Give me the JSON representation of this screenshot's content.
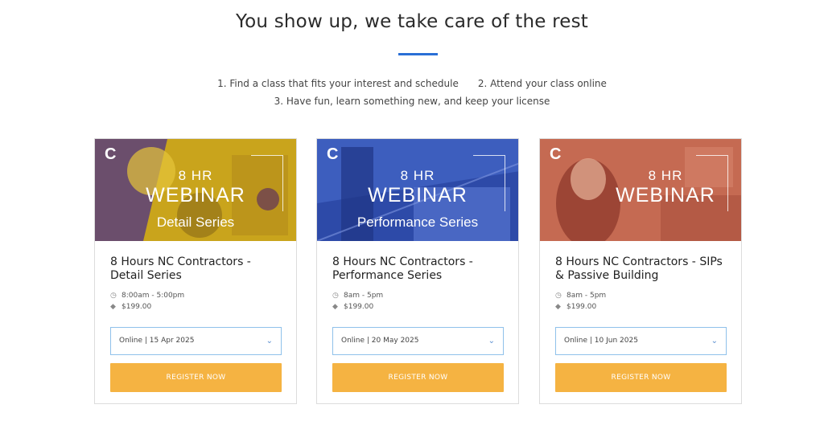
{
  "header": {
    "title": "You show up, we take care of the rest",
    "steps_row1": [
      "1. Find a class that fits your interest and schedule",
      "2. Attend your class online"
    ],
    "steps_row2": "3. Have fun, learn something new, and keep your license",
    "accent_color": "#2a6fd6"
  },
  "cards": [
    {
      "banner": {
        "logo": "C",
        "hours": "8 HR",
        "format": "WEBINAR",
        "series": "Detail Series",
        "tint": "#d8b21e",
        "shade": "#5b3f7a"
      },
      "title": "8 Hours NC Contractors - Detail Series",
      "time": "8:00am - 5:00pm",
      "price": "$199.00",
      "date_option": "Online | 15 Apr 2025",
      "register_label": "REGISTER NOW"
    },
    {
      "banner": {
        "logo": "C",
        "hours": "8 HR",
        "format": "WEBINAR",
        "series": "Performance Series",
        "tint": "#3b5bbf",
        "shade": "#1e2f80"
      },
      "title": "8 Hours NC Contractors - Performance Series",
      "time": "8am - 5pm",
      "price": "$199.00",
      "date_option": "Online | 20 May 2025",
      "register_label": "REGISTER NOW"
    },
    {
      "banner": {
        "logo": "C",
        "hours": "8 HR",
        "format": "WEBINAR",
        "series": "",
        "tint": "#c9664e",
        "shade": "#8e3a2c"
      },
      "title": "8 Hours NC Contractors - SIPs & Passive Building",
      "time": "8am - 5pm",
      "price": "$199.00",
      "date_option": "Online | 10 Jun 2025",
      "register_label": "REGISTER NOW"
    }
  ],
  "icons": {
    "time": "clock-icon",
    "price": "tag-icon",
    "select": "chevron-down-icon"
  },
  "colors": {
    "button": "#f5b342",
    "select_border": "#8fc1ea"
  }
}
